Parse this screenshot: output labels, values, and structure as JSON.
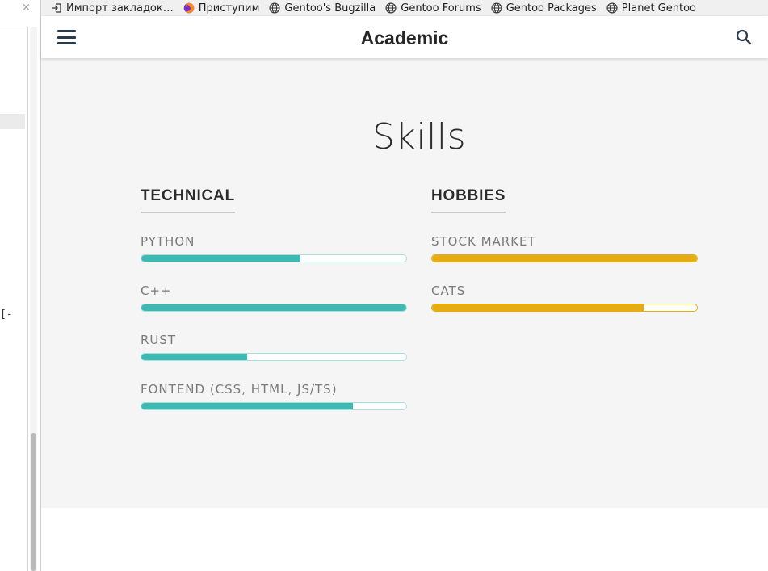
{
  "left_panel": {
    "close_glyph": "×",
    "fragment_text": "[-"
  },
  "bookmarks": [
    {
      "label": "Импорт закладок…",
      "icon": "import-icon"
    },
    {
      "label": "Приступим",
      "icon": "firefox-icon"
    },
    {
      "label": "Gentoo's Bugzilla",
      "icon": "globe-icon"
    },
    {
      "label": "Gentoo Forums",
      "icon": "globe-icon"
    },
    {
      "label": "Gentoo Packages",
      "icon": "globe-icon"
    },
    {
      "label": "Planet Gentoo",
      "icon": "globe-icon"
    }
  ],
  "navbar": {
    "brand": "Academic",
    "menu_icon": "hamburger-menu-icon",
    "search_icon": "search-icon"
  },
  "section": {
    "title": "Skills",
    "columns": [
      {
        "heading": "TECHNICAL",
        "color": "#3db8b3",
        "skills": [
          {
            "name": "PYTHON",
            "level": 0.6
          },
          {
            "name": "C++",
            "level": 1.0
          },
          {
            "name": "RUST",
            "level": 0.4
          },
          {
            "name": "FONTEND (CSS, HTML, JS/TS)",
            "level": 0.8
          }
        ]
      },
      {
        "heading": "HOBBIES",
        "color": "#e6ad13",
        "skills": [
          {
            "name": "STOCK MARKET",
            "level": 1.0
          },
          {
            "name": "CATS",
            "level": 0.8
          }
        ]
      }
    ]
  }
}
